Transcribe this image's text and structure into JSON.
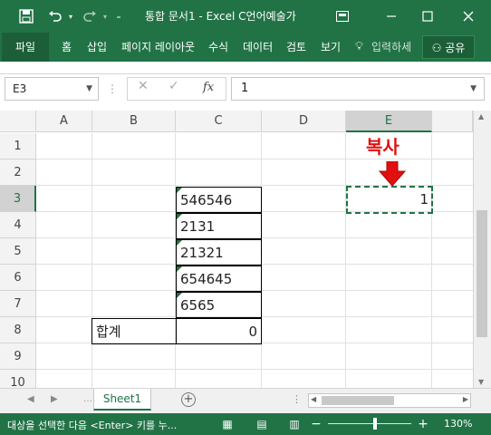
{
  "titlebar": {
    "title": "통합 문서1  -  Excel   C언어예술가",
    "icons": [
      "save-icon",
      "undo-icon",
      "redo-icon",
      "quick-access-menu-icon",
      "ribbon-display-icon",
      "minimize-icon",
      "maximize-icon",
      "close-icon"
    ]
  },
  "ribbon": {
    "tabs": [
      "파일",
      "홈",
      "삽입",
      "페이지 레이아웃",
      "수식",
      "데이터",
      "검토",
      "보기"
    ],
    "tell_me": "입력하세",
    "share": "공유"
  },
  "formula_bar": {
    "name_box": "E3",
    "fx_label": "fx",
    "formula": "1"
  },
  "grid": {
    "columns": [
      "A",
      "B",
      "C",
      "D",
      "E"
    ],
    "rows": [
      "1",
      "2",
      "3",
      "4",
      "5",
      "6",
      "7",
      "8",
      "9",
      "10"
    ],
    "active_cell": "E3",
    "cells": {
      "C3": "546546",
      "C4": "2131",
      "C5": "21321",
      "C6": "654645",
      "C7": "6565",
      "B8": "합계",
      "C8": "0",
      "E3": "1"
    },
    "annotation": "복사"
  },
  "sheets": {
    "tabs": [
      "Sheet1"
    ]
  },
  "statusbar": {
    "message": "대상을 선택한 다음 <Enter> 키를 누...",
    "zoom": "130%",
    "zoom_level": 1.3
  },
  "colors": {
    "excel_green": "#217346",
    "annotation_red": "#e01010"
  }
}
